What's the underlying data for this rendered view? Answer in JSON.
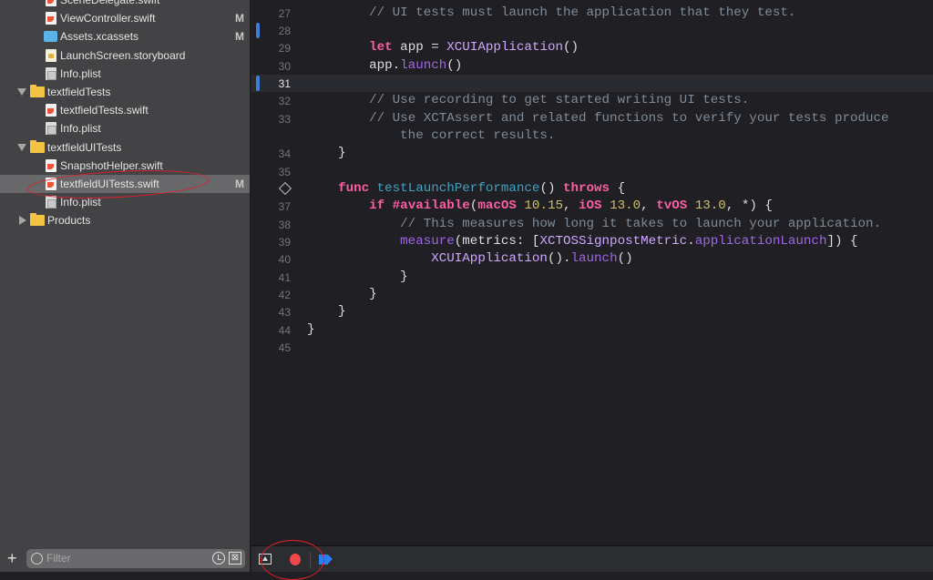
{
  "navigator": {
    "items": [
      {
        "label": "SceneDelegate.swift",
        "icon": "swift-file-icon",
        "kind": "swift",
        "indent": 2,
        "badge": ""
      },
      {
        "label": "ViewController.swift",
        "icon": "swift-file-icon",
        "kind": "swift",
        "indent": 2,
        "badge": "M"
      },
      {
        "label": "Assets.xcassets",
        "icon": "asset-catalog-icon",
        "kind": "assets",
        "indent": 2,
        "badge": "M"
      },
      {
        "label": "LaunchScreen.storyboard",
        "icon": "storyboard-icon",
        "kind": "story",
        "indent": 2,
        "badge": ""
      },
      {
        "label": "Info.plist",
        "icon": "plist-file-icon",
        "kind": "plist",
        "indent": 2,
        "badge": ""
      },
      {
        "label": "textfieldTests",
        "icon": "folder-icon",
        "kind": "folder",
        "indent": 1,
        "open": true,
        "badge": ""
      },
      {
        "label": "textfieldTests.swift",
        "icon": "swift-file-icon",
        "kind": "swift",
        "indent": 2,
        "badge": ""
      },
      {
        "label": "Info.plist",
        "icon": "plist-file-icon",
        "kind": "plist",
        "indent": 2,
        "badge": ""
      },
      {
        "label": "textfieldUITests",
        "icon": "folder-icon",
        "kind": "folder",
        "indent": 1,
        "open": true,
        "badge": ""
      },
      {
        "label": "SnapshotHelper.swift",
        "icon": "swift-file-icon",
        "kind": "swift",
        "indent": 2,
        "badge": ""
      },
      {
        "label": "textfieldUITests.swift",
        "icon": "swift-file-icon",
        "kind": "swift",
        "indent": 2,
        "badge": "M",
        "selected": true
      },
      {
        "label": "Info.plist",
        "icon": "plist-file-icon",
        "kind": "plist",
        "indent": 2,
        "badge": ""
      },
      {
        "label": "Products",
        "icon": "folder-icon",
        "kind": "folder",
        "indent": 1,
        "open": false,
        "badge": ""
      }
    ],
    "filter_placeholder": "Filter",
    "add_label": "+",
    "scope_icon_glyph": "⊠"
  },
  "editor": {
    "current_line": 31,
    "change_markers": [
      28,
      31
    ],
    "test_diamond_line": 36,
    "lines": [
      {
        "n": "27",
        "tokens": [
          [
            "pl",
            "        "
          ],
          [
            "cm",
            "// UI tests must launch the application that they test."
          ]
        ]
      },
      {
        "n": "28",
        "tokens": []
      },
      {
        "n": "29",
        "tokens": [
          [
            "pl",
            "        "
          ],
          [
            "kw",
            "let"
          ],
          [
            "pl",
            " app = "
          ],
          [
            "ty",
            "XCUIApplication"
          ],
          [
            "pl",
            "()"
          ]
        ]
      },
      {
        "n": "30",
        "tokens": [
          [
            "pl",
            "        app."
          ],
          [
            "fn",
            "launch"
          ],
          [
            "pl",
            "()"
          ]
        ]
      },
      {
        "n": "31",
        "tokens": []
      },
      {
        "n": "32",
        "tokens": [
          [
            "pl",
            "        "
          ],
          [
            "cm",
            "// Use recording to get started writing UI tests."
          ]
        ]
      },
      {
        "n": "33",
        "tokens": [
          [
            "pl",
            "        "
          ],
          [
            "cm",
            "// Use XCTAssert and related functions to verify your tests produce"
          ]
        ]
      },
      {
        "n": "",
        "tokens": [
          [
            "pl",
            "            "
          ],
          [
            "cm",
            "the correct results."
          ]
        ]
      },
      {
        "n": "34",
        "tokens": [
          [
            "pl",
            "    }"
          ]
        ]
      },
      {
        "n": "35",
        "tokens": []
      },
      {
        "n": "36",
        "tokens": [
          [
            "pl",
            "    "
          ],
          [
            "kw",
            "func"
          ],
          [
            "pl",
            " "
          ],
          [
            "dec",
            "testLaunchPerformance"
          ],
          [
            "pl",
            "() "
          ],
          [
            "kw",
            "throws"
          ],
          [
            "pl",
            " {"
          ]
        ]
      },
      {
        "n": "37",
        "tokens": [
          [
            "pl",
            "        "
          ],
          [
            "kw",
            "if"
          ],
          [
            "pl",
            " "
          ],
          [
            "kw",
            "#available"
          ],
          [
            "pl",
            "("
          ],
          [
            "kw",
            "macOS"
          ],
          [
            "pl",
            " "
          ],
          [
            "num",
            "10.15"
          ],
          [
            "pl",
            ", "
          ],
          [
            "kw",
            "iOS"
          ],
          [
            "pl",
            " "
          ],
          [
            "num",
            "13.0"
          ],
          [
            "pl",
            ", "
          ],
          [
            "kw",
            "tvOS"
          ],
          [
            "pl",
            " "
          ],
          [
            "num",
            "13.0"
          ],
          [
            "pl",
            ", *) {"
          ]
        ]
      },
      {
        "n": "38",
        "tokens": [
          [
            "pl",
            "            "
          ],
          [
            "cm",
            "// This measures how long it takes to launch your application."
          ]
        ]
      },
      {
        "n": "39",
        "tokens": [
          [
            "pl",
            "            "
          ],
          [
            "fn",
            "measure"
          ],
          [
            "pl",
            "(metrics: ["
          ],
          [
            "ty",
            "XCTOSSignpostMetric"
          ],
          [
            "pl",
            "."
          ],
          [
            "fn",
            "applicationLaunch"
          ],
          [
            "pl",
            "]) {"
          ]
        ]
      },
      {
        "n": "40",
        "tokens": [
          [
            "pl",
            "                "
          ],
          [
            "ty",
            "XCUIApplication"
          ],
          [
            "pl",
            "()."
          ],
          [
            "fn",
            "launch"
          ],
          [
            "pl",
            "()"
          ]
        ]
      },
      {
        "n": "41",
        "tokens": [
          [
            "pl",
            "            }"
          ]
        ]
      },
      {
        "n": "42",
        "tokens": [
          [
            "pl",
            "        }"
          ]
        ]
      },
      {
        "n": "43",
        "tokens": [
          [
            "pl",
            "    }"
          ]
        ]
      },
      {
        "n": "44",
        "tokens": [
          [
            "pl",
            "}"
          ]
        ]
      },
      {
        "n": "45",
        "tokens": []
      }
    ]
  },
  "debug_bar": {
    "record_color": "#f0474a",
    "breakpoint_color": "#2b7ff5"
  },
  "annotation_color": "#e0202a"
}
